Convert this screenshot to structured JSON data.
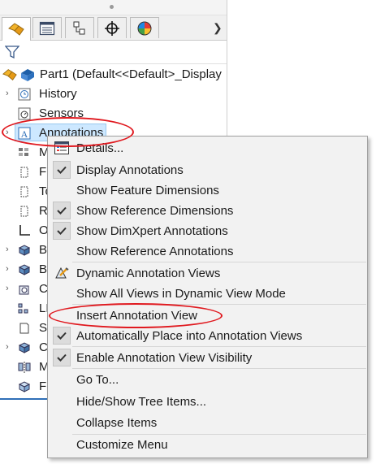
{
  "tabs": [
    {
      "icon": "feature-manager-icon"
    },
    {
      "icon": "property-manager-icon"
    },
    {
      "icon": "configuration-manager-icon"
    },
    {
      "icon": "dimxpert-manager-icon"
    },
    {
      "icon": "display-manager-icon"
    }
  ],
  "tab_next_icon": "chevron-right-icon",
  "tree": {
    "root_label": "Part1  (Default<<Default>_Display",
    "items": [
      {
        "label": "History",
        "icon": "history-icon"
      },
      {
        "label": "Sensors",
        "icon": "sensors-icon"
      },
      {
        "label": "Annotations",
        "icon": "annotations-icon"
      },
      {
        "label": "M",
        "icon": "material-icon"
      },
      {
        "label": "Fr",
        "icon": "plane-icon"
      },
      {
        "label": "To",
        "icon": "plane-icon"
      },
      {
        "label": "Ri",
        "icon": "plane-icon"
      },
      {
        "label": "O",
        "icon": "origin-icon"
      },
      {
        "label": "B",
        "icon": "body-icon"
      },
      {
        "label": "B",
        "icon": "body-icon"
      },
      {
        "label": "C",
        "icon": "cut-icon"
      },
      {
        "label": "LP",
        "icon": "linear-pattern-icon"
      },
      {
        "label": "Sk",
        "icon": "sketch-icon"
      },
      {
        "label": "C",
        "icon": "cut-icon"
      },
      {
        "label": "M",
        "icon": "mirror-icon"
      },
      {
        "label": "Fi",
        "icon": "fillet-icon"
      }
    ]
  },
  "menu": {
    "items": [
      {
        "label": "Details...",
        "icon": "details-icon",
        "checked": false
      },
      {
        "label": "Display Annotations",
        "checked": true
      },
      {
        "label": "Show Feature Dimensions",
        "checked": false
      },
      {
        "label": "Show Reference Dimensions",
        "checked": true
      },
      {
        "label": "Show DimXpert Annotations",
        "checked": true
      },
      {
        "label": "Show Reference Annotations",
        "checked": false
      },
      {
        "label": "Dynamic Annotation Views",
        "icon": "dynamic-annotation-icon",
        "checked": false
      },
      {
        "label": "Show All Views in Dynamic View Mode",
        "checked": false
      },
      {
        "label": "Insert Annotation View",
        "checked": false
      },
      {
        "label": "Automatically Place into Annotation Views",
        "checked": true
      },
      {
        "label": "Enable Annotation View Visibility",
        "checked": true
      },
      {
        "label": "Go To...",
        "checked": false
      },
      {
        "label": "Hide/Show Tree Items...",
        "checked": false
      },
      {
        "label": "Collapse Items",
        "checked": false
      },
      {
        "label": "Customize Menu",
        "checked": false
      }
    ]
  },
  "colors": {
    "highlight_ellipse": "#e0191f",
    "selection": "#cde8ff",
    "menu_bg": "#f2f2f2"
  }
}
